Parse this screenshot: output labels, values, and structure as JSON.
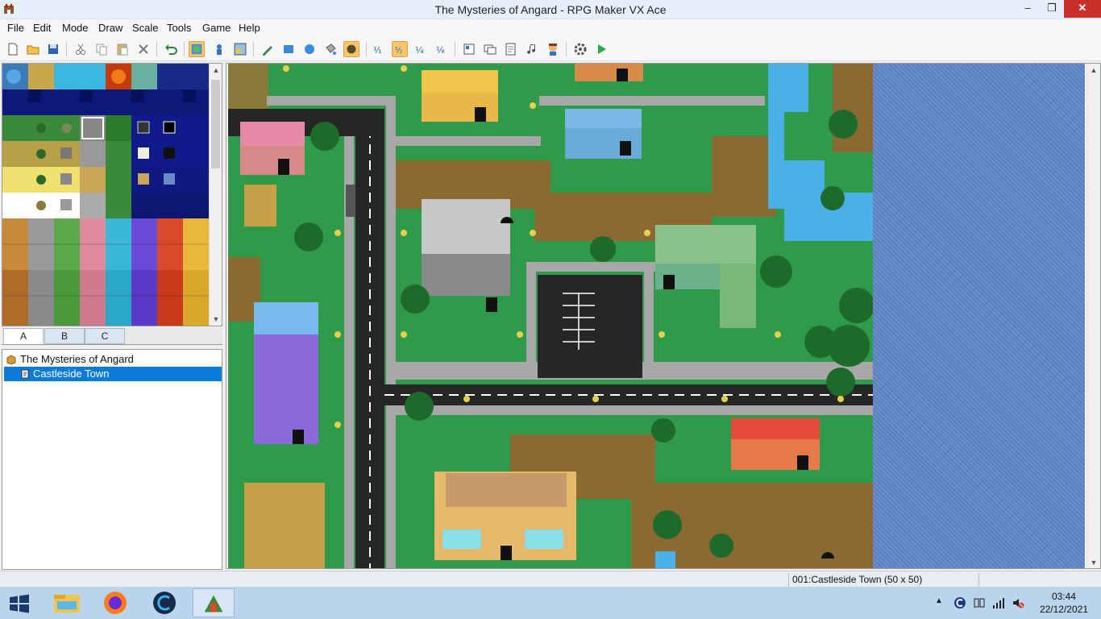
{
  "window": {
    "title": "The Mysteries of Angard - RPG Maker VX Ace",
    "controls": {
      "minimize": "–",
      "maximize": "❐",
      "close": "✕"
    }
  },
  "menu": [
    "File",
    "Edit",
    "Mode",
    "Draw",
    "Scale",
    "Tools",
    "Game",
    "Help"
  ],
  "toolbar": {
    "buttons": [
      {
        "icon": "new-project-icon"
      },
      {
        "icon": "open-project-icon"
      },
      {
        "icon": "save-project-icon"
      },
      {
        "icon": "cut-icon"
      },
      {
        "icon": "copy-icon"
      },
      {
        "icon": "paste-icon"
      },
      {
        "icon": "delete-icon"
      },
      {
        "icon": "undo-icon"
      },
      {
        "icon": "map-mode-icon",
        "active": true
      },
      {
        "icon": "event-mode-icon"
      },
      {
        "icon": "region-mode-icon"
      },
      {
        "icon": "pencil-icon"
      },
      {
        "icon": "rectangle-icon"
      },
      {
        "icon": "ellipse-icon"
      },
      {
        "icon": "flood-fill-icon"
      },
      {
        "icon": "shadow-pen-icon",
        "active": true
      },
      {
        "icon": "scale-1-1-icon"
      },
      {
        "icon": "scale-1-2-icon",
        "active": true
      },
      {
        "icon": "scale-1-4-icon"
      },
      {
        "icon": "scale-1-8-icon"
      },
      {
        "icon": "database-icon"
      },
      {
        "icon": "resource-manager-icon"
      },
      {
        "icon": "script-editor-icon"
      },
      {
        "icon": "sound-test-icon"
      },
      {
        "icon": "character-generator-icon"
      },
      {
        "icon": "options-icon"
      },
      {
        "icon": "playtest-icon"
      }
    ],
    "scale_labels": [
      "1/1",
      "1/2",
      "1/4",
      "1/8"
    ]
  },
  "palette_tabs": [
    "A",
    "B",
    "C"
  ],
  "map_tree": {
    "project": "The Mysteries of Angard",
    "maps": [
      "Castleside Town"
    ]
  },
  "status": {
    "map_info": "001:Castleside Town (50 x 50)"
  },
  "taskbar": {
    "apps": [
      "file-explorer-icon",
      "firefox-icon",
      "ccleaner-icon",
      "rpg-maker-icon"
    ],
    "time": "03:44",
    "date": "22/12/2021"
  },
  "colors": {
    "accent": "#0a7bd8",
    "close": "#c9302c",
    "water": "#5b7fbe",
    "grass": "#2e9a4a"
  }
}
